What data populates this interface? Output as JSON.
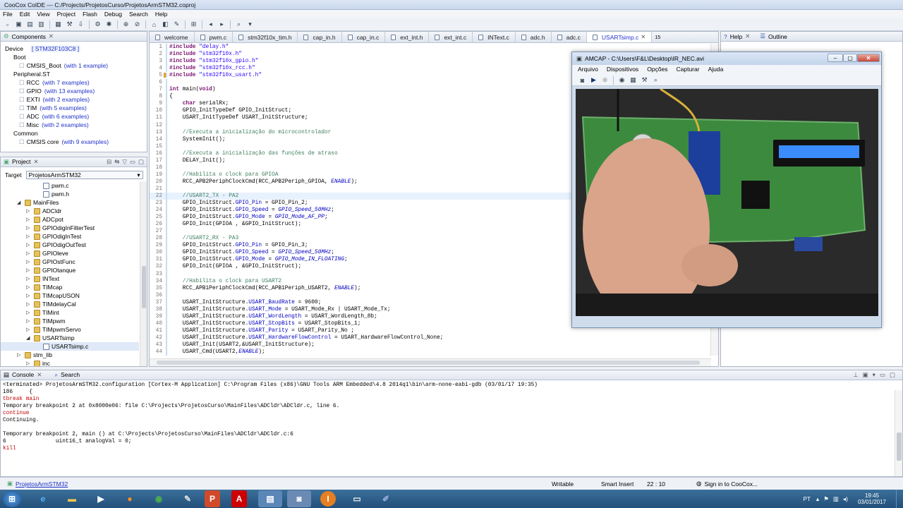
{
  "window": {
    "title": "CooCox CoIDE --- C:/Projects/ProjetosCurso/ProjetosArmSTM32.coproj"
  },
  "menu": [
    "File",
    "Edit",
    "View",
    "Project",
    "Flash",
    "Debug",
    "Search",
    "Help"
  ],
  "components": {
    "tab": "Components",
    "device_label": "Device",
    "device_value": "[ STM32F103C8 ]",
    "tree": [
      {
        "t": "Boot",
        "d": 0
      },
      {
        "t": "CMSIS_Boot",
        "e": "(with 1 example)",
        "d": 1
      },
      {
        "t": "Peripheral.ST",
        "d": 0
      },
      {
        "t": "RCC",
        "e": "(with 7 examples)",
        "d": 1
      },
      {
        "t": "GPIO",
        "e": "(with 13 examples)",
        "d": 1
      },
      {
        "t": "EXTI",
        "e": "(with 2 examples)",
        "d": 1
      },
      {
        "t": "TIM",
        "e": "(with 5 examples)",
        "d": 1
      },
      {
        "t": "ADC",
        "e": "(with 6 examples)",
        "d": 1
      },
      {
        "t": "Misc",
        "e": "(with 2 examples)",
        "d": 1
      },
      {
        "t": "Common",
        "d": 0
      },
      {
        "t": "CMSIS core",
        "e": "(with 9 examples)",
        "d": 1
      }
    ]
  },
  "project": {
    "tab": "Project",
    "target_label": "Target",
    "target_value": "ProjetosArmSTM32",
    "tree": [
      {
        "t": "pwm.c",
        "d": 3,
        "k": "f"
      },
      {
        "t": "pwm.h",
        "d": 3,
        "k": "f"
      },
      {
        "t": "MainFiles",
        "d": 1,
        "k": "d",
        "open": true
      },
      {
        "t": "ADCldr",
        "d": 2,
        "k": "d"
      },
      {
        "t": "ADCpot",
        "d": 2,
        "k": "d"
      },
      {
        "t": "GPIOdigInFilterTest",
        "d": 2,
        "k": "d"
      },
      {
        "t": "GPIOdigInTest",
        "d": 2,
        "k": "d"
      },
      {
        "t": "GPIOdigOutTest",
        "d": 2,
        "k": "d"
      },
      {
        "t": "GPIOleve",
        "d": 2,
        "k": "d"
      },
      {
        "t": "GPIOstFunc",
        "d": 2,
        "k": "d"
      },
      {
        "t": "GPIOtanque",
        "d": 2,
        "k": "d"
      },
      {
        "t": "INText",
        "d": 2,
        "k": "d"
      },
      {
        "t": "TIMcap",
        "d": 2,
        "k": "d"
      },
      {
        "t": "TIMcapUSON",
        "d": 2,
        "k": "d"
      },
      {
        "t": "TIMdelayCal",
        "d": 2,
        "k": "d"
      },
      {
        "t": "TIMint",
        "d": 2,
        "k": "d"
      },
      {
        "t": "TIMpwm",
        "d": 2,
        "k": "d"
      },
      {
        "t": "TIMpwmServo",
        "d": 2,
        "k": "d"
      },
      {
        "t": "USARTsimp",
        "d": 2,
        "k": "d",
        "open": true
      },
      {
        "t": "USARTsimp.c",
        "d": 3,
        "k": "f",
        "sel": true
      },
      {
        "t": "stm_lib",
        "d": 1,
        "k": "d"
      },
      {
        "t": "inc",
        "d": 2,
        "k": "d"
      }
    ]
  },
  "editor": {
    "tabs": [
      "welcome",
      "pwm.c",
      "stm32f10x_tim.h",
      "cap_in.h",
      "cap_in.c",
      "ext_int.h",
      "ext_int.c",
      "INText.c",
      "adc.h",
      "adc.c",
      "USARTsimp.c"
    ],
    "active_tab": "USARTsimp.c",
    "overflow": "15",
    "lines": [
      {
        "n": "1",
        "t": "#include \"delay.h\""
      },
      {
        "n": "2",
        "t": "#include \"stm32f10x.h\""
      },
      {
        "n": "3",
        "t": "#include \"stm32f10x_gpio.h\""
      },
      {
        "n": "4",
        "t": "#include \"stm32f10x_rcc.h\""
      },
      {
        "n": "5",
        "t": "#include \"stm32f10x_usart.h\""
      },
      {
        "n": "6",
        "t": ""
      },
      {
        "n": "7",
        "t": "int main(void)"
      },
      {
        "n": "8",
        "t": "{"
      },
      {
        "n": "9",
        "t": "    char serialRx;"
      },
      {
        "n": "10",
        "t": "    GPIO_InitTypeDef GPIO_InitStruct;"
      },
      {
        "n": "11",
        "t": "    USART_InitTypeDef USART_InitStructure;"
      },
      {
        "n": "12",
        "t": ""
      },
      {
        "n": "13",
        "t": "    //Executa a inicialização do microcontrolador"
      },
      {
        "n": "14",
        "t": "    SystemInit();"
      },
      {
        "n": "15",
        "t": ""
      },
      {
        "n": "16",
        "t": "    //Executa a inicialização das funções de atraso"
      },
      {
        "n": "17",
        "t": "    DELAY_Init();"
      },
      {
        "n": "18",
        "t": ""
      },
      {
        "n": "19",
        "t": "    //Habilita o clock para GPIOA"
      },
      {
        "n": "20",
        "t": "    RCC_APB2PeriphClockCmd(RCC_APB2Periph_GPIOA, ENABLE);"
      },
      {
        "n": "21",
        "t": ""
      },
      {
        "n": "22",
        "t": "    //USART2_TX - PA2"
      },
      {
        "n": "23",
        "t": "    GPIO_InitStruct.GPIO_Pin = GPIO_Pin_2;"
      },
      {
        "n": "24",
        "t": "    GPIO_InitStruct.GPIO_Speed = GPIO_Speed_50MHz;"
      },
      {
        "n": "25",
        "t": "    GPIO_InitStruct.GPIO_Mode = GPIO_Mode_AF_PP;"
      },
      {
        "n": "26",
        "t": "    GPIO_Init(GPIOA , &GPIO_InitStruct);"
      },
      {
        "n": "27",
        "t": ""
      },
      {
        "n": "28",
        "t": "    //USART2_RX - PA3"
      },
      {
        "n": "29",
        "t": "    GPIO_InitStruct.GPIO_Pin = GPIO_Pin_3;"
      },
      {
        "n": "30",
        "t": "    GPIO_InitStruct.GPIO_Speed = GPIO_Speed_50MHz;"
      },
      {
        "n": "31",
        "t": "    GPIO_InitStruct.GPIO_Mode = GPIO_Mode_IN_FLOATING;"
      },
      {
        "n": "32",
        "t": "    GPIO_Init(GPIOA , &GPIO_InitStruct);"
      },
      {
        "n": "33",
        "t": ""
      },
      {
        "n": "34",
        "t": "    //Habilita o clock para USART2"
      },
      {
        "n": "35",
        "t": "    RCC_APB1PeriphClockCmd(RCC_APB1Periph_USART2, ENABLE);"
      },
      {
        "n": "36",
        "t": ""
      },
      {
        "n": "37",
        "t": "    USART_InitStructure.USART_BaudRate = 9600;"
      },
      {
        "n": "38",
        "t": "    USART_InitStructure.USART_Mode = USART_Mode_Rx | USART_Mode_Tx;"
      },
      {
        "n": "39",
        "t": "    USART_InitStructure.USART_WordLength = USART_WordLength_8b;"
      },
      {
        "n": "40",
        "t": "    USART_InitStructure.USART_StopBits = USART_StopBits_1;"
      },
      {
        "n": "41",
        "t": "    USART_InitStructure.USART_Parity = USART_Parity_No ;"
      },
      {
        "n": "42",
        "t": "    USART_InitStructure.USART_HardwareFlowControl = USART_HardwareFlowControl_None;"
      },
      {
        "n": "43",
        "t": "    USART_Init(USART2,&USART_InitStructure);"
      },
      {
        "n": "44",
        "t": "    USART_Cmd(USART2,ENABLE);"
      }
    ]
  },
  "help": {
    "tab": "Help",
    "outline_tab": "Outline"
  },
  "amcap": {
    "title": "AMCAP - C:\\Users\\F&L\\Desktop\\IR_NEC.avi",
    "menu": [
      "Arquivo",
      "Dispositivos",
      "Opções",
      "Capturar",
      "Ajuda"
    ]
  },
  "console": {
    "tab": "Console",
    "search_tab": "Search",
    "header": "<terminated> ProjetosArmSTM32.configuration [Cortex-M Application] C:\\Program Files (x86)\\GNU Tools ARM Embedded\\4.8 2014q1\\bin\\arm-none-eabi-gdb (03/01/17 19:35)",
    "lines": [
      {
        "t": "186     {",
        "r": false
      },
      {
        "t": "tbreak main",
        "r": true
      },
      {
        "t": "Temporary breakpoint 2 at 0x8000e06: file C:\\Projects\\ProjetosCurso\\MainFiles\\ADCldr\\ADCldr.c, line 6.",
        "r": false
      },
      {
        "t": "continue",
        "r": true
      },
      {
        "t": "Continuing.",
        "r": false
      },
      {
        "t": "",
        "r": false
      },
      {
        "t": "Temporary breakpoint 2, main () at C:\\Projects\\ProjetosCurso\\MainFiles\\ADCldr\\ADCldr.c:6",
        "r": false
      },
      {
        "t": "6               uint16_t analogVal = 0;",
        "r": false
      },
      {
        "t": "kill",
        "r": true
      }
    ]
  },
  "status": {
    "project": "ProjetosArmSTM32",
    "writable": "Writable",
    "insert": "Smart Insert",
    "position": "22 : 10",
    "signin": "Sign in to CooCox..."
  },
  "taskbar": {
    "lang": "PT",
    "time": "19:45",
    "date": "03/01/2017"
  }
}
